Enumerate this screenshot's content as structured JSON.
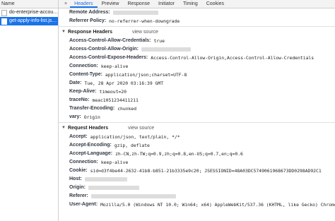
{
  "sidebar": {
    "header": "Name",
    "requests": [
      {
        "label": "do-enterprise-accou…"
      },
      {
        "label": "get-apply-info-list.js…"
      }
    ]
  },
  "tabs": {
    "close": "×",
    "items": [
      {
        "label": "Headers"
      },
      {
        "label": "Preview"
      },
      {
        "label": "Response"
      },
      {
        "label": "Initiator"
      },
      {
        "label": "Timing"
      },
      {
        "label": "Cookies"
      }
    ]
  },
  "general": {
    "remote_address_key": "Remote Address:",
    "referrer_policy_key": "Referrer Policy:",
    "referrer_policy_value": "no-referrer-when-downgrade"
  },
  "response_headers": {
    "title": "Response Headers",
    "view_source": "view source",
    "rows": [
      {
        "k": "Access-Control-Allow-Credentials:",
        "v": "true"
      },
      {
        "k": "Access-Control-Allow-Origin:",
        "v": ""
      },
      {
        "k": "Access-Control-Expose-Headers:",
        "v": "Access-Control-Allow-Origin,Access-Control-Allow-Credentials"
      },
      {
        "k": "Connection:",
        "v": "keep-alive"
      },
      {
        "k": "Content-Type:",
        "v": "application/json;charset=UTF-8"
      },
      {
        "k": "Date:",
        "v": "Tue, 28 Apr 2020 03:16:39 GMT"
      },
      {
        "k": "Keep-Alive:",
        "v": "timeout=20"
      },
      {
        "k": "traceNo:",
        "v": "meac1051234411211"
      },
      {
        "k": "Transfer-Encoding:",
        "v": "chunked"
      },
      {
        "k": "vary:",
        "v": "Origin"
      }
    ]
  },
  "request_headers": {
    "title": "Request Headers",
    "view_source": "view source",
    "rows": [
      {
        "k": "Accept:",
        "v": "application/json, text/plain, */*"
      },
      {
        "k": "Accept-Encoding:",
        "v": "gzip, deflate"
      },
      {
        "k": "Accept-Language:",
        "v": "zh-CN,zh-TW;q=0.9,zh;q=0.8,en-US;q=0.7,en;q=0.6"
      },
      {
        "k": "Connection:",
        "v": "keep-alive"
      },
      {
        "k": "Cookie:",
        "v": "sid=d3f4be44-2632-41b8-b851-21b3335e9c20; JSESSIONID=48A03DC5749061968673DD0298AD92C1"
      },
      {
        "k": "Host:",
        "v": ""
      },
      {
        "k": "Origin:",
        "v": ""
      },
      {
        "k": "Referer:",
        "v": ""
      },
      {
        "k": "User-Agent:",
        "v": "Mozilla/5.0 (Windows NT 10.0; Win64; x64) AppleWebKit/537.36 (KHTML, like Gecko) Chrome"
      }
    ]
  }
}
